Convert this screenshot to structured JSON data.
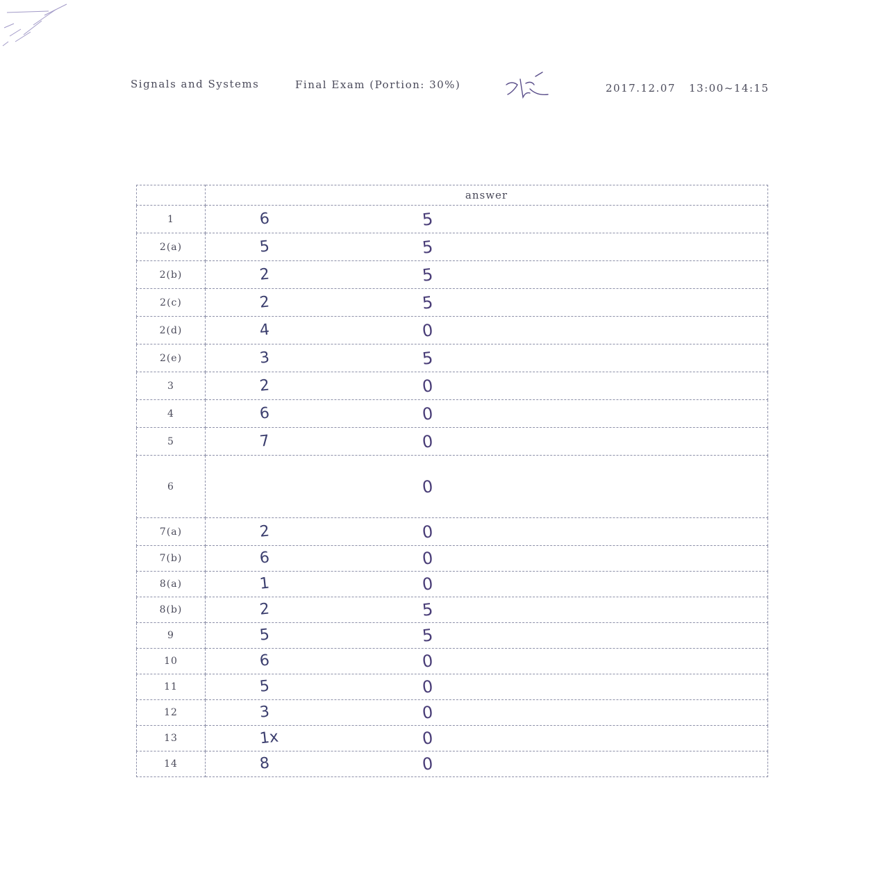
{
  "header": {
    "course": "Signals and Systems",
    "exam": "Final Exam (Portion: 30%)",
    "initials": "",
    "date": "2017.12.07",
    "time": "13:00~14:15"
  },
  "table": {
    "column_header": "answer",
    "rows": [
      {
        "q": "1",
        "answer": "6",
        "score": "5"
      },
      {
        "q": "2(a)",
        "answer": "5",
        "score": "5"
      },
      {
        "q": "2(b)",
        "answer": "2",
        "score": "5"
      },
      {
        "q": "2(c)",
        "answer": "2",
        "score": "5"
      },
      {
        "q": "2(d)",
        "answer": "4",
        "score": "0"
      },
      {
        "q": "2(e)",
        "answer": "3",
        "score": "5"
      },
      {
        "q": "3",
        "answer": "2",
        "score": "0"
      },
      {
        "q": "4",
        "answer": "6",
        "score": "0"
      },
      {
        "q": "5",
        "answer": "7",
        "score": "0"
      },
      {
        "q": "6",
        "answer": "",
        "score": "0"
      },
      {
        "q": "7(a)",
        "answer": "2",
        "score": "0"
      },
      {
        "q": "7(b)",
        "answer": "6",
        "score": "0"
      },
      {
        "q": "8(a)",
        "answer": "1",
        "score": "0"
      },
      {
        "q": "8(b)",
        "answer": "2",
        "score": "5"
      },
      {
        "q": "9",
        "answer": "5",
        "score": "5"
      },
      {
        "q": "10",
        "answer": "6",
        "score": "0"
      },
      {
        "q": "11",
        "answer": "5",
        "score": "0"
      },
      {
        "q": "12",
        "answer": "3",
        "score": "0"
      },
      {
        "q": "13",
        "answer": "1x",
        "score": "0"
      },
      {
        "q": "14",
        "answer": "8",
        "score": "0"
      }
    ]
  }
}
